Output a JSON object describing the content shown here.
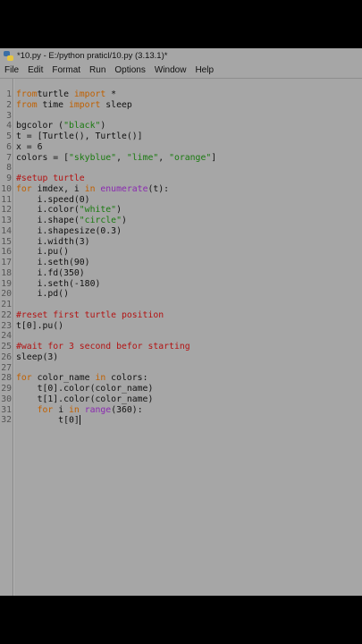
{
  "window": {
    "title": "*10.py - E:/python praticl/10.py (3.13.1)*"
  },
  "menu": [
    "File",
    "Edit",
    "Format",
    "Run",
    "Options",
    "Window",
    "Help"
  ],
  "code_lines": [
    {
      "n": "1",
      "segs": [
        [
          "kw",
          "from"
        ],
        [
          "",
          "turtle "
        ],
        [
          "kw",
          "import"
        ],
        [
          "",
          " *"
        ]
      ]
    },
    {
      "n": "2",
      "segs": [
        [
          "kw",
          "from"
        ],
        [
          "",
          " time "
        ],
        [
          "kw",
          "import"
        ],
        [
          "",
          " sleep"
        ]
      ]
    },
    {
      "n": "3",
      "segs": []
    },
    {
      "n": "4",
      "segs": [
        [
          "",
          "bgcolor ("
        ],
        [
          "str",
          "\"black\""
        ],
        [
          "",
          ")"
        ]
      ]
    },
    {
      "n": "5",
      "segs": [
        [
          "",
          "t = [Turtle(), Turtle()]"
        ]
      ]
    },
    {
      "n": "6",
      "segs": [
        [
          "",
          "x = 6"
        ]
      ]
    },
    {
      "n": "7",
      "segs": [
        [
          "",
          "colors = ["
        ],
        [
          "str",
          "\"skyblue\""
        ],
        [
          "",
          ", "
        ],
        [
          "str",
          "\"lime\""
        ],
        [
          "",
          ", "
        ],
        [
          "str",
          "\"orange\""
        ],
        [
          "",
          "]"
        ]
      ]
    },
    {
      "n": "8",
      "segs": []
    },
    {
      "n": "9",
      "segs": [
        [
          "cm",
          "#setup turtle"
        ]
      ]
    },
    {
      "n": "10",
      "segs": [
        [
          "kw",
          "for"
        ],
        [
          "",
          " imdex, i "
        ],
        [
          "kw",
          "in"
        ],
        [
          "",
          " "
        ],
        [
          "bi",
          "enumerate"
        ],
        [
          "",
          "(t):"
        ]
      ]
    },
    {
      "n": "11",
      "segs": [
        [
          "",
          "    i.speed(0)"
        ]
      ]
    },
    {
      "n": "12",
      "segs": [
        [
          "",
          "    i.color("
        ],
        [
          "str",
          "\"white\""
        ],
        [
          "",
          ")"
        ]
      ]
    },
    {
      "n": "13",
      "segs": [
        [
          "",
          "    i.shape("
        ],
        [
          "str",
          "\"circle\""
        ],
        [
          "",
          ")"
        ]
      ]
    },
    {
      "n": "14",
      "segs": [
        [
          "",
          "    i.shapesize(0.3)"
        ]
      ]
    },
    {
      "n": "15",
      "segs": [
        [
          "",
          "    i.width(3)"
        ]
      ]
    },
    {
      "n": "16",
      "segs": [
        [
          "",
          "    i.pu()"
        ]
      ]
    },
    {
      "n": "17",
      "segs": [
        [
          "",
          "    i.seth(90)"
        ]
      ]
    },
    {
      "n": "18",
      "segs": [
        [
          "",
          "    i.fd(350)"
        ]
      ]
    },
    {
      "n": "19",
      "segs": [
        [
          "",
          "    i.seth(-180)"
        ]
      ]
    },
    {
      "n": "20",
      "segs": [
        [
          "",
          "    i.pd()"
        ]
      ]
    },
    {
      "n": "21",
      "segs": []
    },
    {
      "n": "22",
      "segs": [
        [
          "cm",
          "#reset first turtle position"
        ]
      ]
    },
    {
      "n": "23",
      "segs": [
        [
          "",
          "t[0].pu()"
        ]
      ]
    },
    {
      "n": "24",
      "segs": []
    },
    {
      "n": "25",
      "segs": [
        [
          "cm",
          "#wait for 3 second befor starting"
        ]
      ]
    },
    {
      "n": "26",
      "segs": [
        [
          "",
          "sleep(3)"
        ]
      ]
    },
    {
      "n": "27",
      "segs": []
    },
    {
      "n": "28",
      "segs": [
        [
          "kw",
          "for"
        ],
        [
          "",
          " color_name "
        ],
        [
          "kw",
          "in"
        ],
        [
          "",
          " colors:"
        ]
      ]
    },
    {
      "n": "29",
      "segs": [
        [
          "",
          "    t[0].color(color_name)"
        ]
      ]
    },
    {
      "n": "30",
      "segs": [
        [
          "",
          "    t[1].color(color_name)"
        ]
      ]
    },
    {
      "n": "31",
      "segs": [
        [
          "",
          "    "
        ],
        [
          "kw",
          "for"
        ],
        [
          "",
          " i "
        ],
        [
          "kw",
          "in"
        ],
        [
          "",
          " "
        ],
        [
          "bi",
          "range"
        ],
        [
          "",
          "(360):"
        ]
      ]
    },
    {
      "n": "32",
      "segs": [
        [
          "",
          "        t[0]"
        ]
      ]
    }
  ],
  "cursor_line": "32"
}
